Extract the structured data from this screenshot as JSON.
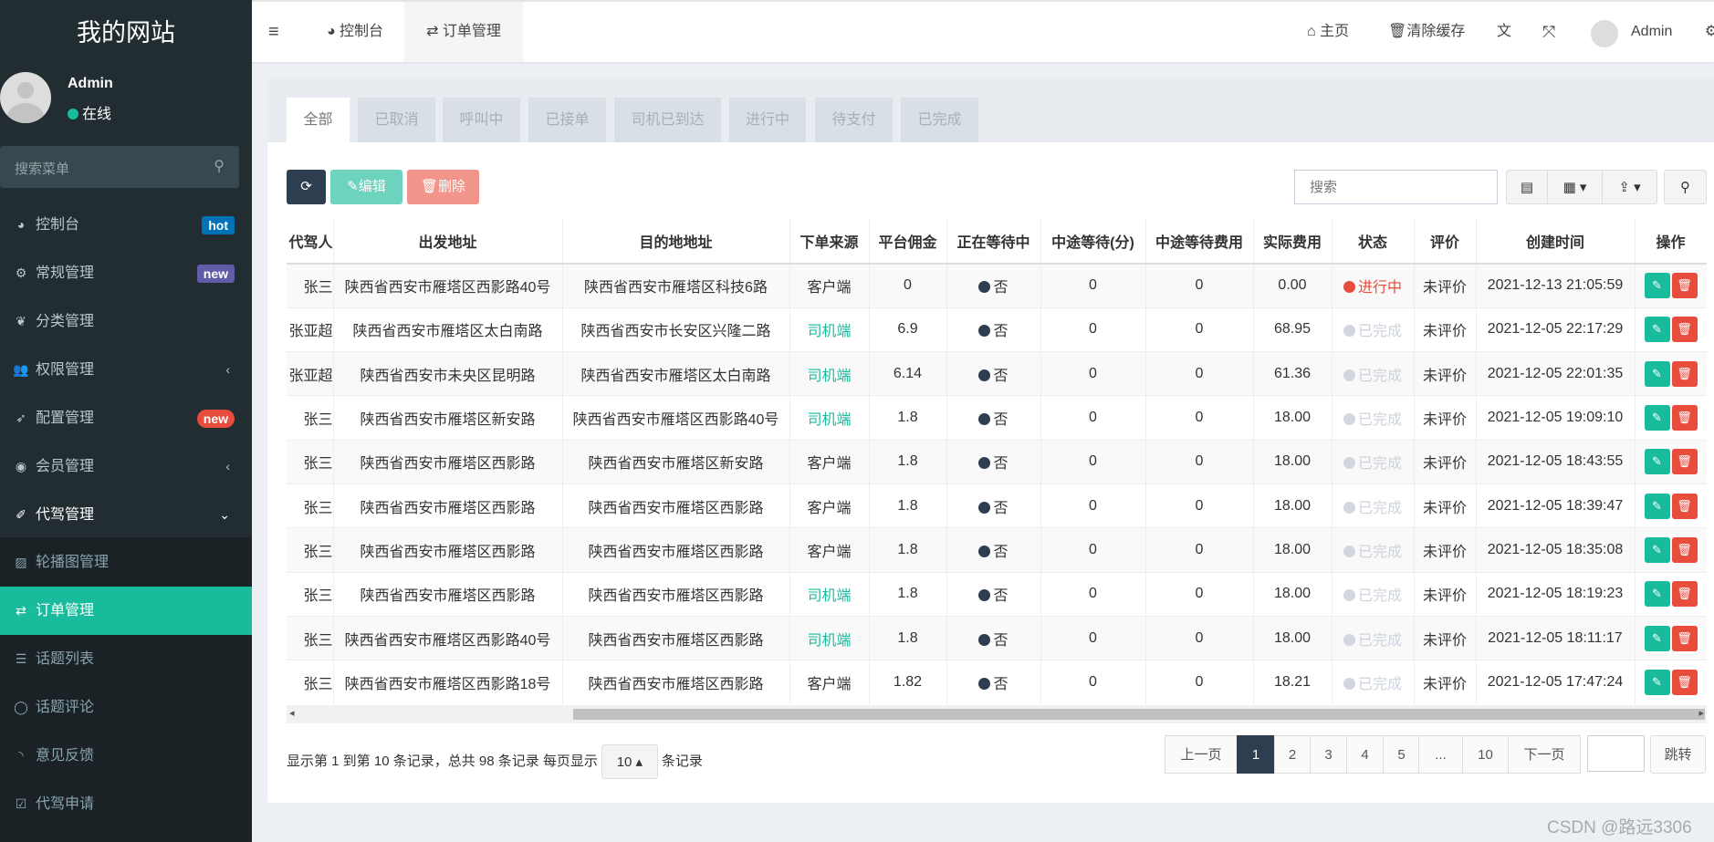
{
  "sidebar": {
    "logo": "我的网站",
    "user": {
      "name": "Admin",
      "status": "在线"
    },
    "search_placeholder": "搜索菜单",
    "items": [
      {
        "label": "控制台",
        "icon": "dashboard-icon",
        "badge": "hot",
        "badge_color": "#0073b7"
      },
      {
        "label": "常规管理",
        "icon": "cogs-icon",
        "badge": "new",
        "badge_color": "#605ca8"
      },
      {
        "label": "分类管理",
        "icon": "leaf-icon"
      },
      {
        "label": "权限管理",
        "icon": "users-icon",
        "arrow": "‹"
      },
      {
        "label": "配置管理",
        "icon": "rocket-icon",
        "badge": "new",
        "badge_color": "#e74c3c"
      },
      {
        "label": "会员管理",
        "icon": "user-circle-icon",
        "arrow": "‹"
      },
      {
        "label": "代驾管理",
        "icon": "magic-icon",
        "arrow": "⌄"
      }
    ],
    "subitems": [
      {
        "label": "轮播图管理",
        "icon": "image-icon"
      },
      {
        "label": "订单管理",
        "icon": "exchange-icon",
        "active": true
      },
      {
        "label": "话题列表",
        "icon": "list-icon"
      },
      {
        "label": "话题评论",
        "icon": "comment-icon"
      },
      {
        "label": "意见反馈",
        "icon": "rss-icon"
      },
      {
        "label": "代驾申请",
        "icon": "check-square-icon"
      }
    ]
  },
  "header": {
    "tabs": [
      {
        "label": "控制台"
      },
      {
        "label": "订单管理",
        "active": true
      }
    ],
    "home": "主页",
    "clear_cache": "清除缓存",
    "user": "Admin"
  },
  "filter_tabs": [
    "全部",
    "已取消",
    "呼叫中",
    "已接单",
    "司机已到达",
    "进行中",
    "待支付",
    "已完成"
  ],
  "toolbar": {
    "edit": "编辑",
    "delete": "删除",
    "search_placeholder": "搜索"
  },
  "table": {
    "columns": [
      "代驾人",
      "出发地址",
      "目的地地址",
      "下单来源",
      "平台佣金",
      "正在等待中",
      "中途等待(分)",
      "中途等待费用",
      "实际费用",
      "状态",
      "评价",
      "创建时间",
      "操作"
    ],
    "rows": [
      [
        "张三",
        "陕西省西安市雁塔区西影路40号",
        "陕西省西安市雁塔区科技6路",
        "客户端",
        "0",
        "否",
        "0",
        "0",
        "0.00",
        "进行中",
        "未评价",
        "2021-12-13 21:05:59"
      ],
      [
        "张亚超",
        "陕西省西安市雁塔区太白南路",
        "陕西省西安市长安区兴隆二路",
        "司机端",
        "6.9",
        "否",
        "0",
        "0",
        "68.95",
        "已完成",
        "未评价",
        "2021-12-05 22:17:29"
      ],
      [
        "张亚超",
        "陕西省西安市未央区昆明路",
        "陕西省西安市雁塔区太白南路",
        "司机端",
        "6.14",
        "否",
        "0",
        "0",
        "61.36",
        "已完成",
        "未评价",
        "2021-12-05 22:01:35"
      ],
      [
        "张三",
        "陕西省西安市雁塔区新安路",
        "陕西省西安市雁塔区西影路40号",
        "司机端",
        "1.8",
        "否",
        "0",
        "0",
        "18.00",
        "已完成",
        "未评价",
        "2021-12-05 19:09:10"
      ],
      [
        "张三",
        "陕西省西安市雁塔区西影路",
        "陕西省西安市雁塔区新安路",
        "客户端",
        "1.8",
        "否",
        "0",
        "0",
        "18.00",
        "已完成",
        "未评价",
        "2021-12-05 18:43:55"
      ],
      [
        "张三",
        "陕西省西安市雁塔区西影路",
        "陕西省西安市雁塔区西影路",
        "客户端",
        "1.8",
        "否",
        "0",
        "0",
        "18.00",
        "已完成",
        "未评价",
        "2021-12-05 18:39:47"
      ],
      [
        "张三",
        "陕西省西安市雁塔区西影路",
        "陕西省西安市雁塔区西影路",
        "客户端",
        "1.8",
        "否",
        "0",
        "0",
        "18.00",
        "已完成",
        "未评价",
        "2021-12-05 18:35:08"
      ],
      [
        "张三",
        "陕西省西安市雁塔区西影路",
        "陕西省西安市雁塔区西影路",
        "司机端",
        "1.8",
        "否",
        "0",
        "0",
        "18.00",
        "已完成",
        "未评价",
        "2021-12-05 18:19:23"
      ],
      [
        "张三",
        "陕西省西安市雁塔区西影路40号",
        "陕西省西安市雁塔区西影路",
        "司机端",
        "1.8",
        "否",
        "0",
        "0",
        "18.00",
        "已完成",
        "未评价",
        "2021-12-05 18:11:17"
      ],
      [
        "张三",
        "陕西省西安市雁塔区西影路18号",
        "陕西省西安市雁塔区西影路",
        "客户端",
        "1.82",
        "否",
        "0",
        "0",
        "18.21",
        "已完成",
        "未评价",
        "2021-12-05 17:47:24"
      ]
    ]
  },
  "pagination": {
    "info_prefix": "显示第 1 到第 10 条记录，总共 98 条记录 每页显示",
    "page_size": "10",
    "info_suffix": "条记录",
    "prev": "上一页",
    "pages": [
      "1",
      "2",
      "3",
      "4",
      "5",
      "...",
      "10"
    ],
    "current": "1",
    "next": "下一页",
    "jump": "跳转"
  },
  "watermark": "CSDN @路远3306",
  "colors": {
    "sidebar": "#222d32",
    "accent": "#18bc9c",
    "danger": "#e74c3c",
    "primary": "#2c3e50"
  }
}
